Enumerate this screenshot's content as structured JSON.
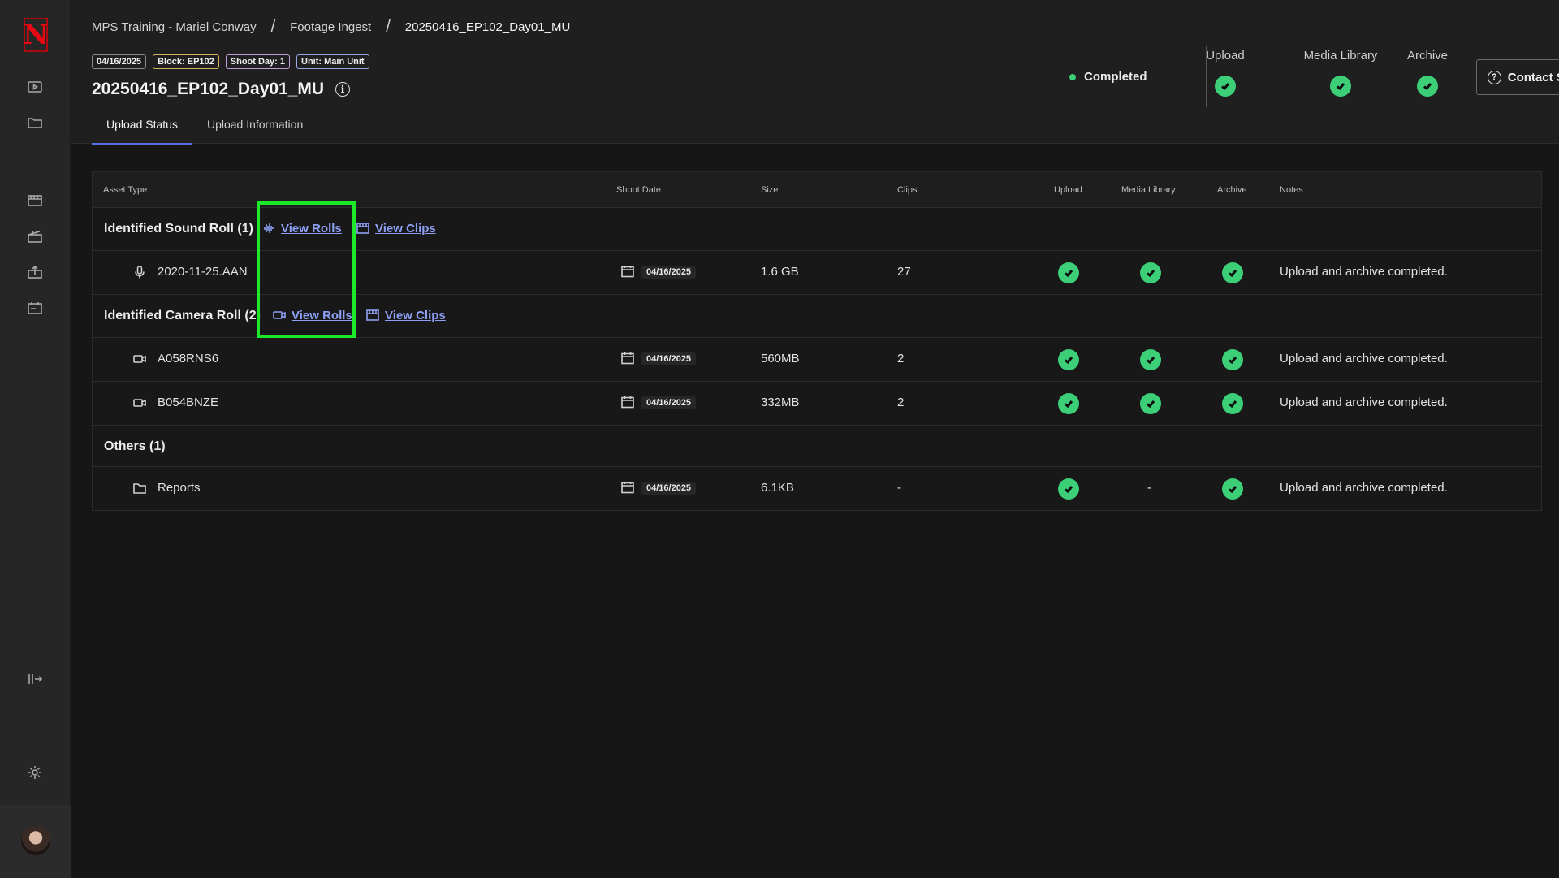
{
  "brand": {
    "logo_letter": "N"
  },
  "sidebar": {
    "icons": [
      "play-square-icon",
      "folder-icon",
      "film-icon",
      "clapper-icon",
      "camera-upload-icon",
      "calendar-box-icon",
      "collapse-sidebar-icon",
      "gear-icon"
    ]
  },
  "breadcrumb": {
    "items": [
      "MPS Training - Mariel Conway",
      "Footage Ingest",
      "20250416_EP102_Day01_MU"
    ],
    "separator": "/"
  },
  "tags": {
    "date": "04/16/2025",
    "block": "Block: EP102",
    "day": "Shoot Day: 1",
    "unit": "Unit: Main Unit"
  },
  "title": "20250416_EP102_Day01_MU",
  "tabs": {
    "upload_status": "Upload Status",
    "upload_information": "Upload Information"
  },
  "status": {
    "label": "Completed",
    "color": "#3ccf78"
  },
  "stages": {
    "upload": "Upload",
    "media_library": "Media Library",
    "archive": "Archive"
  },
  "support": {
    "label": "Contact Support"
  },
  "table": {
    "headers": {
      "asset_type": "Asset Type",
      "shoot_date": "Shoot Date",
      "size": "Size",
      "clips": "Clips",
      "upload": "Upload",
      "media_library": "Media Library",
      "archive": "Archive",
      "notes": "Notes"
    },
    "groups": {
      "sound": {
        "label": "Identified Sound Roll (1)",
        "view_rolls": "View Rolls",
        "view_clips": "View Clips"
      },
      "camera": {
        "label": "Identified Camera Roll (2)",
        "view_rolls": "View Rolls",
        "view_clips": "View Clips"
      },
      "others": {
        "label": "Others (1)"
      }
    },
    "rows": {
      "sound1": {
        "name": "2020-11-25.AAN",
        "date": "04/16/2025",
        "size": "1.6 GB",
        "clips": "27",
        "notes": "Upload and archive completed."
      },
      "cam1": {
        "name": "A058RNS6",
        "date": "04/16/2025",
        "size": "560MB",
        "clips": "2",
        "notes": "Upload and archive completed."
      },
      "cam2": {
        "name": "B054BNZE",
        "date": "04/16/2025",
        "size": "332MB",
        "clips": "2",
        "notes": "Upload and archive completed."
      },
      "other1": {
        "name": "Reports",
        "date": "04/16/2025",
        "size": "6.1KB",
        "clips": "-",
        "media_library": "-",
        "notes": "Upload and archive completed."
      }
    }
  },
  "colors": {
    "accent": "#5a6ee0",
    "link": "#8ea0f5",
    "success": "#3ccf78",
    "highlight": "#1ee82a"
  }
}
